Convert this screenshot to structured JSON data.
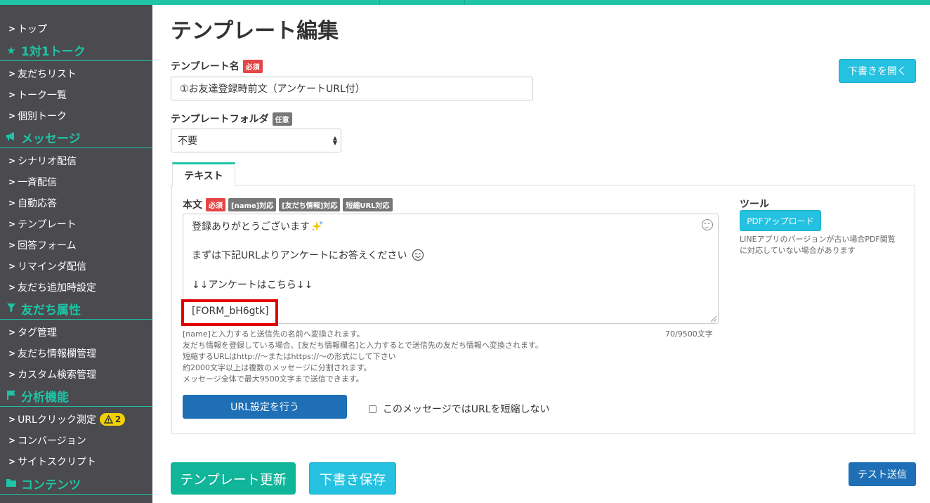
{
  "sidebar": {
    "items": [
      {
        "type": "item",
        "label": "トップ"
      },
      {
        "type": "section",
        "icon": "star-icon",
        "label": "1対1トーク"
      },
      {
        "type": "item",
        "label": "友だちリスト"
      },
      {
        "type": "item",
        "label": "トーク一覧"
      },
      {
        "type": "item",
        "label": "個別トーク"
      },
      {
        "type": "section",
        "icon": "megaphone-icon",
        "label": "メッセージ"
      },
      {
        "type": "item",
        "label": "シナリオ配信"
      },
      {
        "type": "item",
        "label": "一斉配信"
      },
      {
        "type": "item",
        "label": "自動応答"
      },
      {
        "type": "item",
        "label": "テンプレート"
      },
      {
        "type": "item",
        "label": "回答フォーム"
      },
      {
        "type": "item",
        "label": "リマインダ配信"
      },
      {
        "type": "item",
        "label": "友だち追加時設定"
      },
      {
        "type": "section",
        "icon": "filter-icon",
        "label": "友だち属性"
      },
      {
        "type": "item",
        "label": "タグ管理"
      },
      {
        "type": "item",
        "label": "友だち情報欄管理"
      },
      {
        "type": "item",
        "label": "カスタム検索管理"
      },
      {
        "type": "section",
        "icon": "flag-icon",
        "label": "分析機能"
      },
      {
        "type": "item",
        "label": "URLクリック測定",
        "badge": "2"
      },
      {
        "type": "item",
        "label": "コンバージョン"
      },
      {
        "type": "item",
        "label": "サイトスクリプト"
      },
      {
        "type": "section",
        "icon": "folder-icon",
        "label": "コンテンツ"
      }
    ]
  },
  "page": {
    "title": "テンプレート編集",
    "open_draft_button": "下書きを開く",
    "name_label": "テンプレート名",
    "required_badge": "必須",
    "name_value": "①お友達登録時前文（アンケートURL付）",
    "folder_label": "テンプレートフォルダ",
    "optional_badge": "任意",
    "folder_value": "不要"
  },
  "editor": {
    "tab_text": "テキスト",
    "body_label": "本文",
    "required_badge": "必須",
    "tags": [
      "[name]対応",
      "[友だち情報]対応",
      "短縮URL対応"
    ],
    "lines": [
      "登録ありがとうございます",
      "まずは下記URLよりアンケートにお答えください",
      "↓↓アンケートはこちら↓↓",
      "[FORM_bH6gtk]"
    ],
    "counter": "70/9500文字",
    "help": [
      "[name]と入力すると送信先の名前へ変換されます。",
      "友だち情報を登録している場合、[友だち情報欄名]と入力するとで送信先の友だち情報へ変換されます。",
      "短縮するURLはhttp://〜またはhttps://〜の形式にして下さい",
      "約2000文字以上は複数のメッセージに分割されます。",
      "メッセージ全体で最大9500文字まで送信できます。"
    ],
    "url_button": "URL設定を行う",
    "no_shorten_label": "このメッセージではURLを短縮しない",
    "tools_title": "ツール",
    "pdf_button": "PDFアップロード",
    "pdf_note": "LINEアプリのバージョンが古い場合PDF閲覧に対応していない場合があります"
  },
  "footer": {
    "update_button": "テンプレート更新",
    "save_draft_button": "下書き保存",
    "test_send_button": "テスト送信"
  },
  "colors": {
    "accent": "#1ec4a5",
    "sidebar_bg": "#4a4a4f",
    "required": "#e54545",
    "highlight": "#e00000",
    "cyan_button": "#24c1e0",
    "blue_button": "#1e6fb5"
  }
}
